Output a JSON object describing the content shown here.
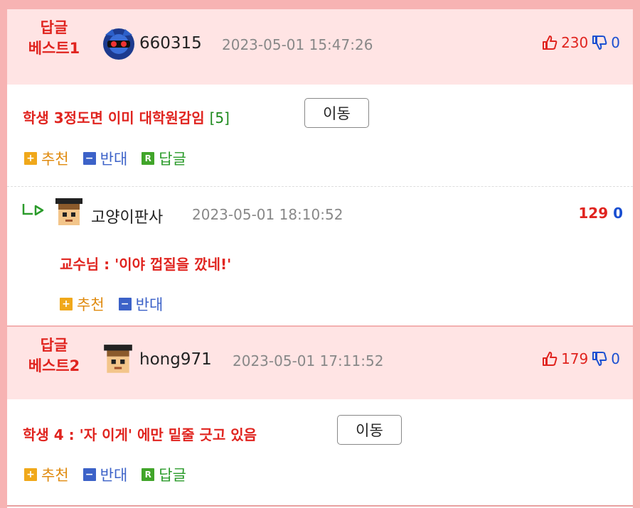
{
  "best_comments": [
    {
      "label_line1": "답글",
      "label_line2": "베스트1",
      "username": "660315",
      "date": "2023-05-01 15:47:26",
      "upvotes": "230",
      "downvotes": "0",
      "text": "학생 3정도면 이미 대학원감임",
      "reply_count": "[5]",
      "move_label": "이동",
      "actions": {
        "recommend": "추천",
        "oppose": "반대",
        "reply": "답글"
      }
    },
    {
      "label_line1": "답글",
      "label_line2": "베스트2",
      "username": "hong971",
      "date": "2023-05-01 17:11:52",
      "upvotes": "179",
      "downvotes": "0",
      "text": "학생 4 : '자 이게' 에만 밑줄 긋고 있음",
      "move_label": "이동",
      "actions": {
        "recommend": "추천",
        "oppose": "반대",
        "reply": "답글"
      }
    }
  ],
  "sub_reply": {
    "username": "고양이판사",
    "date": "2023-05-01 18:10:52",
    "upvotes": "129",
    "downvotes": "0",
    "text": "교수님 : '이야 껍질을 깠네!'",
    "actions": {
      "recommend": "추천",
      "oppose": "반대"
    }
  },
  "icons": {
    "thumb_up": "thumbs-up-icon",
    "thumb_down": "thumbs-down-icon",
    "plus": "plus-square-icon",
    "minus": "minus-square-icon",
    "reply": "reply-square-icon",
    "reply_arrow": "reply-arrow-icon"
  },
  "colors": {
    "accent_red": "#e0241f",
    "blue": "#1a4fd1",
    "green": "#2b9b2b",
    "orange": "#e08b10"
  }
}
